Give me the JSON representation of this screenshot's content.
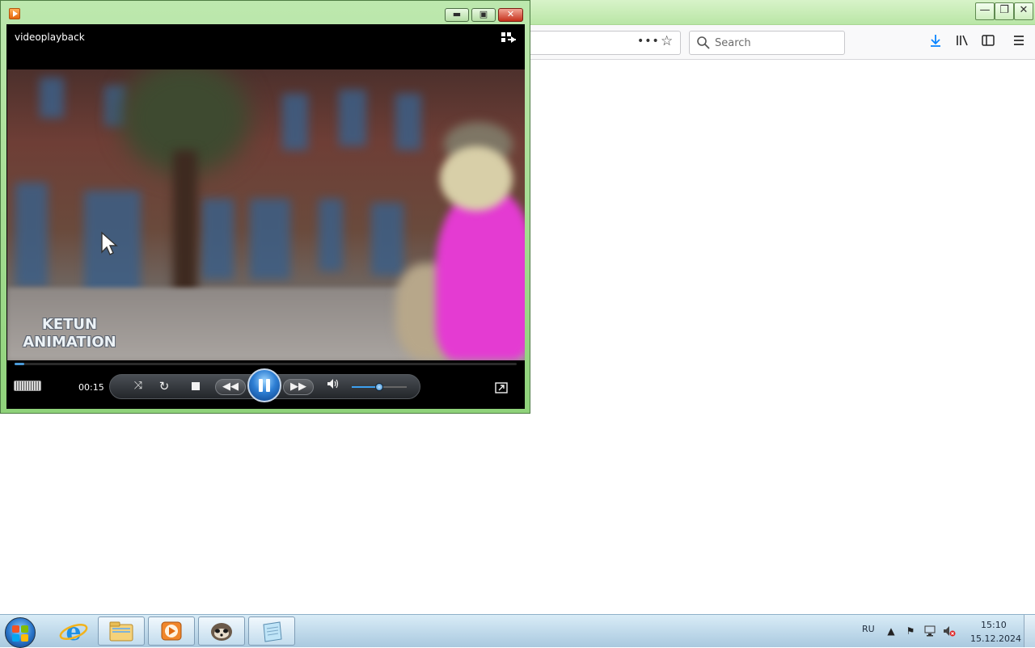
{
  "browser": {
    "search_placeholder": "Search",
    "url_more": "•••",
    "titlebar_buttons": [
      "minimize",
      "restore",
      "close"
    ]
  },
  "player": {
    "title": "videoplayback",
    "watermark_line1": "KETUN",
    "watermark_line2": "ANIMATION",
    "time": "00:15",
    "progress": 0.02,
    "volume": 0.5,
    "state": "playing"
  },
  "taskbar": {
    "language": "RU",
    "clock_time": "15:10",
    "clock_date": "15.12.2024",
    "pinned": [
      "internet-explorer",
      "windows-explorer",
      "windows-media-player",
      "game-app",
      "notepad-app"
    ]
  },
  "colors": {
    "wmp_frame": "#9bd887",
    "accent_blue": "#2e7fd4",
    "close_red": "#c6311c"
  }
}
